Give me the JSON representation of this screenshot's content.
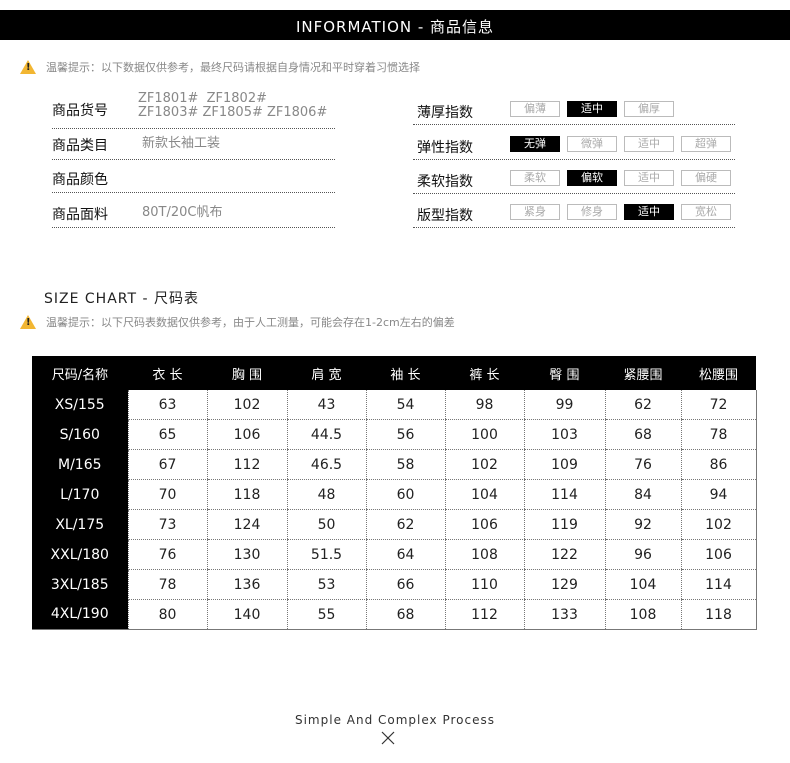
{
  "header": {
    "title": "INFORMATION - 商品信息"
  },
  "info_notice": "温馨提示：以下数据仅供参考，最终尺码请根据自身情况和平时穿着习惯选择",
  "product": {
    "sku_label": "商品货号",
    "sku_line1": "ZF1801#  ZF1802#",
    "sku_line2": "ZF1803# ZF1805# ZF1806#",
    "category_label": "商品类目",
    "category_value": "新款长袖工装",
    "color_label": "商品颜色",
    "color_value": "",
    "fabric_label": "商品面料",
    "fabric_value": "80T/20C帆布"
  },
  "indices": [
    {
      "label": "薄厚指数",
      "options": [
        "偏薄",
        "适中",
        "偏厚"
      ],
      "selected": 1
    },
    {
      "label": "弹性指数",
      "options": [
        "无弹",
        "微弹",
        "适中",
        "超弹"
      ],
      "selected": 0
    },
    {
      "label": "柔软指数",
      "options": [
        "柔软",
        "偏软",
        "适中",
        "偏硬"
      ],
      "selected": 1
    },
    {
      "label": "版型指数",
      "options": [
        "紧身",
        "修身",
        "适中",
        "宽松"
      ],
      "selected": 2
    }
  ],
  "size_chart": {
    "title": "SIZE CHART - 尺码表",
    "notice": "温馨提示：以下尺码表数据仅供参考，由于人工测量，可能会存在1-2cm左右的偏差",
    "columns": [
      "尺码/名称",
      "衣 长",
      "胸 围",
      "肩 宽",
      "袖 长",
      "裤 长",
      "臀 围",
      "紧腰围",
      "松腰围"
    ],
    "rows": [
      [
        "XS/155",
        "63",
        "102",
        "43",
        "54",
        "98",
        "99",
        "62",
        "72"
      ],
      [
        "S/160",
        "65",
        "106",
        "44.5",
        "56",
        "100",
        "103",
        "68",
        "78"
      ],
      [
        "M/165",
        "67",
        "112",
        "46.5",
        "58",
        "102",
        "109",
        "76",
        "86"
      ],
      [
        "L/170",
        "70",
        "118",
        "48",
        "60",
        "104",
        "114",
        "84",
        "94"
      ],
      [
        "XL/175",
        "73",
        "124",
        "50",
        "62",
        "106",
        "119",
        "92",
        "102"
      ],
      [
        "XXL/180",
        "76",
        "130",
        "51.5",
        "64",
        "108",
        "122",
        "96",
        "106"
      ],
      [
        "3XL/185",
        "78",
        "136",
        "53",
        "66",
        "110",
        "129",
        "104",
        "114"
      ],
      [
        "4XL/190",
        "80",
        "140",
        "55",
        "68",
        "112",
        "133",
        "108",
        "118"
      ]
    ]
  },
  "footer": {
    "text": "Simple And Complex Process"
  }
}
